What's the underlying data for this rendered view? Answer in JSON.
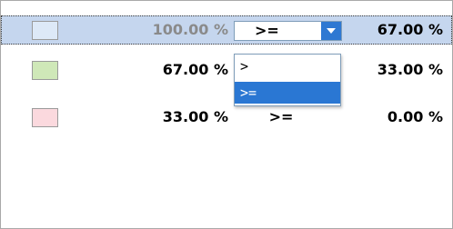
{
  "rows": [
    {
      "color": "#dde9f7",
      "from_value": "100.00 %",
      "operator": ">=",
      "to_value": "67.00 %"
    },
    {
      "color": "#cfe8b8",
      "from_value": "67.00 %",
      "operator": ">=",
      "to_value": "33.00 %"
    },
    {
      "color": "#fbd9de",
      "from_value": "33.00 %",
      "operator": ">=",
      "to_value": "0.00 %"
    }
  ],
  "dropdown": {
    "current": ">=",
    "options": [
      ">",
      ">="
    ],
    "selected_index": 1
  },
  "colors": {
    "selection_row": "#c5d6ee",
    "dropdown_button": "#2e78d2",
    "dropdown_highlight": "#2a77d3",
    "dim_text": "#8a8a8a"
  }
}
